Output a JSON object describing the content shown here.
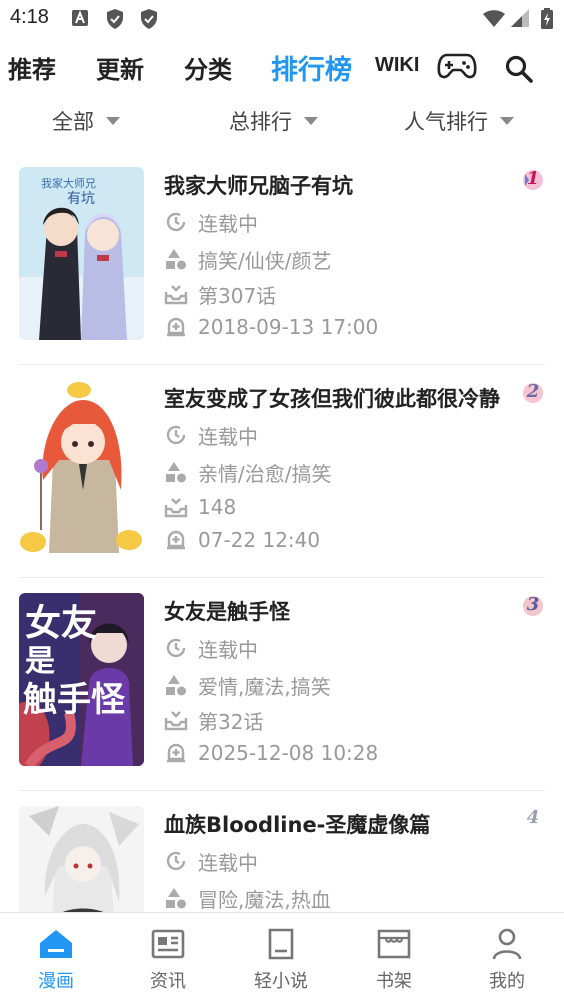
{
  "status_bar": {
    "time": "4:18"
  },
  "top_nav": {
    "tabs": [
      {
        "label": "推荐"
      },
      {
        "label": "更新"
      },
      {
        "label": "分类"
      },
      {
        "label": "排行榜"
      },
      {
        "label": "WIKI"
      }
    ],
    "active_tab": "排行榜",
    "accent_color": "#2196f3"
  },
  "filters": [
    {
      "label": "全部"
    },
    {
      "label": "总排行"
    },
    {
      "label": "人气排行"
    }
  ],
  "comics": [
    {
      "title": "我家大师兄脑子有坑",
      "status": "连载中",
      "tags": "搞笑/仙侠/颜艺",
      "latest": "第307话",
      "updated": "2018-09-13 17:00",
      "rank": "1"
    },
    {
      "title": "室友变成了女孩但我们彼此都很冷静",
      "status": "连载中",
      "tags": "亲情/治愈/搞笑",
      "latest": "148",
      "updated": "07-22 12:40",
      "rank": "2"
    },
    {
      "title": "女友是触手怪",
      "status": "连载中",
      "tags": "爱情,魔法,搞笑",
      "latest": "第32话",
      "updated": "2025-12-08 10:28",
      "rank": "3"
    },
    {
      "title": "血族Bloodline-圣魔虚像篇",
      "status": "连载中",
      "tags": "冒险,魔法,热血",
      "latest": "",
      "updated": "",
      "rank": "4"
    }
  ],
  "bottom_nav": [
    {
      "label": "漫画",
      "icon": "home-icon"
    },
    {
      "label": "资讯",
      "icon": "news-icon"
    },
    {
      "label": "轻小说",
      "icon": "book-icon"
    },
    {
      "label": "书架",
      "icon": "bookshelf-icon"
    },
    {
      "label": "我的",
      "icon": "profile-icon"
    }
  ],
  "active_bottom": "漫画"
}
